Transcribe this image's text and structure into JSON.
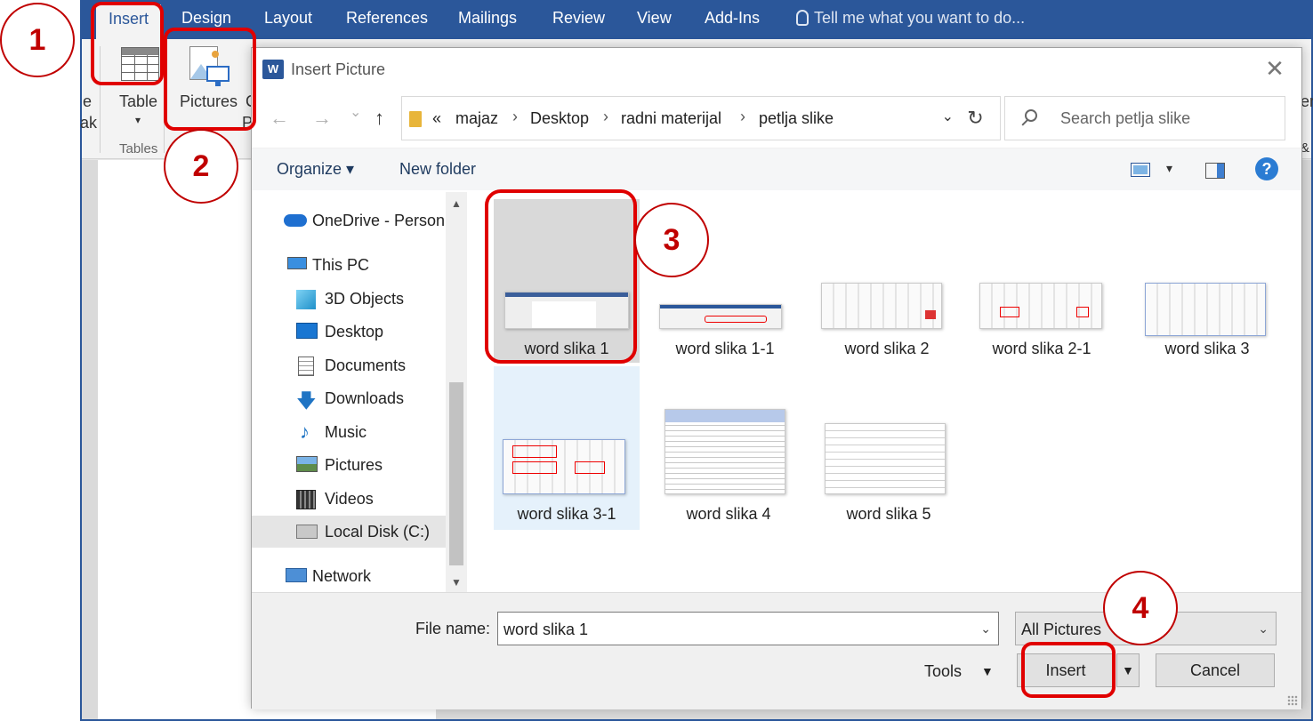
{
  "ribbon": {
    "tabs": [
      "Insert",
      "Design",
      "Layout",
      "References",
      "Mailings",
      "Review",
      "View",
      "Add-Ins"
    ],
    "tell_me": "Tell me what you want to do...",
    "partial_left_1": "e",
    "partial_left_2": "ak",
    "table_label": "Table",
    "pictures_label": "Pictures",
    "partial_right_1": "C",
    "partial_right_2": "P",
    "group_tables": "Tables",
    "partial_far_right_1": "er",
    "partial_far_right_2": "&"
  },
  "annotations": [
    "1",
    "2",
    "3",
    "4"
  ],
  "dialog": {
    "title": "Insert Picture",
    "close": "✕",
    "nav": {
      "back": "←",
      "forward": "→",
      "recent": "⌄",
      "up": "↑",
      "overflow": "«",
      "breadcrumbs": [
        "majaz",
        "Desktop",
        "radni materijal",
        "petlja slike"
      ],
      "separator": "›",
      "dropdown": "⌄",
      "refresh": "↻",
      "search_placeholder": "Search petlja slike"
    },
    "commands": {
      "organize": "Organize ▾",
      "new_folder": "New folder",
      "view_dropdown": "▾",
      "help": "?"
    },
    "sidebar": {
      "scroll_up": "▲",
      "scroll_down": "▼",
      "items": [
        {
          "label": "OneDrive - Person",
          "icon": "cloud-icon"
        },
        {
          "label": "This PC",
          "icon": "computer-icon"
        },
        {
          "label": "3D Objects",
          "icon": "cube-icon"
        },
        {
          "label": "Desktop",
          "icon": "desktop-icon"
        },
        {
          "label": "Documents",
          "icon": "document-icon"
        },
        {
          "label": "Downloads",
          "icon": "download-icon"
        },
        {
          "label": "Music",
          "icon": "music-icon"
        },
        {
          "label": "Pictures",
          "icon": "pictures-icon"
        },
        {
          "label": "Videos",
          "icon": "videos-icon"
        },
        {
          "label": "Local Disk (C:)",
          "icon": "disk-icon"
        },
        {
          "label": "Network",
          "icon": "network-icon"
        }
      ]
    },
    "files": [
      {
        "name": "word slika 1"
      },
      {
        "name": "word slika 1-1"
      },
      {
        "name": "word slika 2"
      },
      {
        "name": "word slika 2-1"
      },
      {
        "name": "word slika 3"
      },
      {
        "name": "word slika 3-1"
      },
      {
        "name": "word slika 4"
      },
      {
        "name": "word slika 5"
      }
    ],
    "footer": {
      "file_name_label": "File name:",
      "file_name_value": "word slika 1",
      "file_type": "All Pictures",
      "dropdown": "⌄",
      "tools_label": "Tools",
      "tools_dropdown": "▼",
      "insert_label": "Insert",
      "insert_dropdown": "▼",
      "cancel_label": "Cancel"
    }
  },
  "colors": {
    "word_blue": "#2b579a",
    "annotation_red": "#e00000",
    "selected_tile": "#d9d9d9",
    "hover_tile": "#e5f1fb",
    "help_blue": "#2b7cd3"
  }
}
